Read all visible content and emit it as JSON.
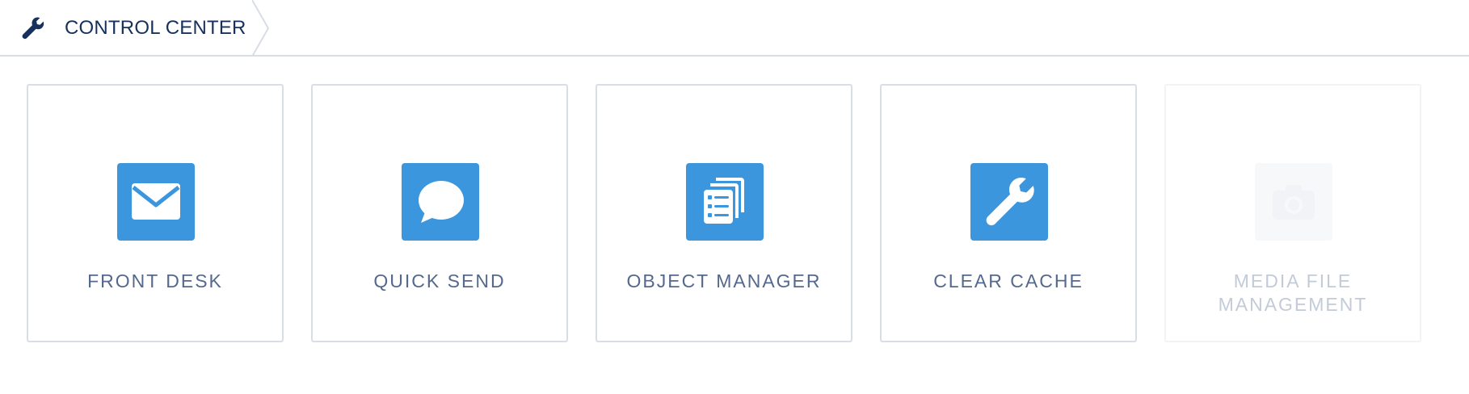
{
  "header": {
    "title": "CONTROL CENTER",
    "icon": "wrench-icon"
  },
  "tiles": [
    {
      "label": "FRONT DESK",
      "icon": "envelope-icon",
      "enabled": true
    },
    {
      "label": "QUICK SEND",
      "icon": "chat-bubble-icon",
      "enabled": true
    },
    {
      "label": "OBJECT MANAGER",
      "icon": "stacked-list-icon",
      "enabled": true
    },
    {
      "label": "CLEAR CACHE",
      "icon": "wrench-icon",
      "enabled": true
    },
    {
      "label": "MEDIA FILE MANAGEMENT",
      "icon": "camera-icon",
      "enabled": false
    }
  ],
  "colors": {
    "accent": "#3b96dd",
    "text": "#54698d",
    "title": "#16325c",
    "border": "#d8dde6",
    "disabled_text": "#c3cbd8"
  }
}
